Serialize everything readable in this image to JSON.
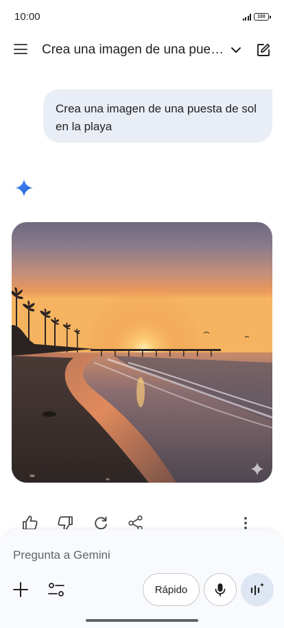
{
  "status_bar": {
    "time": "10:00",
    "battery": "100"
  },
  "app_bar": {
    "title": "Crea una imagen de una puesta de sol en la playa"
  },
  "conversation": {
    "user_message": "Crea una imagen de una puesta de sol en la playa"
  },
  "composer": {
    "placeholder": "Pregunta a Gemini",
    "mode_label": "Rápido"
  },
  "icons": {
    "menu": "menu-icon",
    "chevron": "chevron-down-icon",
    "edit": "edit-icon",
    "spark": "gemini-spark-icon",
    "thumbs_up": "thumbs-up-icon",
    "thumbs_down": "thumbs-down-icon",
    "regenerate": "regenerate-icon",
    "share": "share-icon",
    "more": "more-vert-icon",
    "plus": "plus-icon",
    "tools": "tools-icon",
    "mic": "mic-icon",
    "live": "live-icon"
  },
  "colors": {
    "bubble": "#e9eef6",
    "accent": "#1a73e8",
    "live_button": "#dfe6f3"
  }
}
